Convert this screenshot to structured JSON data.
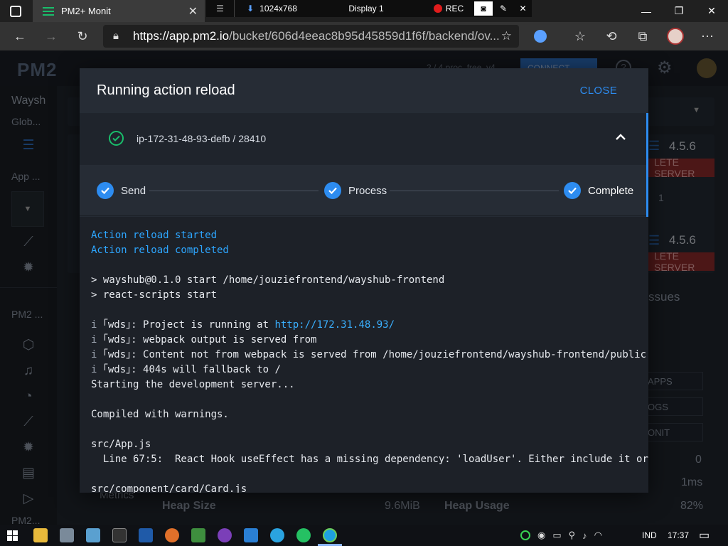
{
  "browser": {
    "tab_title": "PM2+ Monit",
    "url_host": "https://app.pm2.io",
    "url_path": "/bucket/606d4eeac8b95d45859d1f6f/backend/ov..."
  },
  "recorder": {
    "resolution": "1024x768",
    "display": "Display 1",
    "rec_label": "REC"
  },
  "background": {
    "brand": "PM2",
    "bucket_name": "Waysh",
    "sidebar_global": "Glob...",
    "sidebar_app": "App ...",
    "sidebar_pm2": "PM2 ...",
    "sidebar_pm2_2": "PM2...",
    "plan_text": "2 / 4 proc.  free_v4",
    "connect_label": "CONNECT",
    "version_1": "4.5.6",
    "version_2": "4.5.6",
    "delete_server_1": "LETE SERVER",
    "delete_server_2": "LETE SERVER",
    "count_1": "1",
    "issues_label": "ssues",
    "apps_btn": "APPS",
    "logs_btn": "OGS",
    "monit_btn": "ONIT",
    "stat_value_1": "0",
    "stat_value_2": "1ms",
    "heap_size_label": "Heap Size",
    "heap_size_value": "9.6MiB",
    "heap_usage_label": "Heap Usage",
    "heap_usage_value": "82%",
    "metrics_label": "Metrics"
  },
  "modal": {
    "title": "Running action reload",
    "close_label": "CLOSE",
    "server_label": "ip-172-31-48-93-defb / 28410",
    "steps": [
      {
        "label": "Send"
      },
      {
        "label": "Process"
      },
      {
        "label": "Complete"
      }
    ],
    "console": {
      "status_1": "Action reload started",
      "status_2": "Action reload completed",
      "line_start": "> wayshub@0.1.0 start /home/jouziefrontend/wayshub-frontend",
      "line_scripts": "> react-scripts start",
      "wds_1_prefix": "｢wds｣: Project is running at ",
      "wds_1_link": "http://172.31.48.93/",
      "wds_2": "｢wds｣: webpack output is served from",
      "wds_3": "｢wds｣: Content not from webpack is served from /home/jouziefrontend/wayshub-frontend/public",
      "wds_4": "｢wds｣: 404s will fallback to /",
      "info_glyph": "i",
      "starting": "Starting the development server...",
      "compiled": "Compiled with warnings.",
      "file_1": "src/App.js",
      "warning_1": "  Line 67:5:  React Hook useEffect has a missing dependency: 'loadUser'. Either include it or",
      "file_2": "src/component/card/Card.js"
    }
  },
  "taskbar": {
    "lang": "IND",
    "time": "17:37"
  },
  "colors": {
    "accent": "#2d8cf0",
    "success": "#19be6b",
    "console_blue": "#2da6ff"
  }
}
